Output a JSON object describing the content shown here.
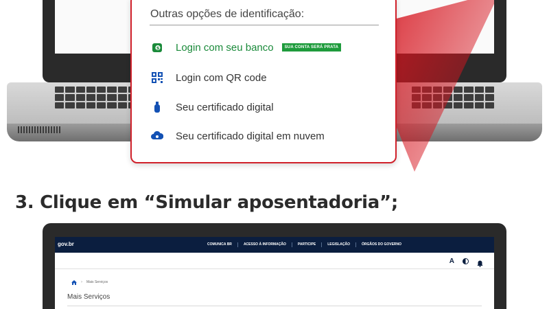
{
  "login_card": {
    "title": "Outras opções de identificação:",
    "options": [
      {
        "label": "Login com seu banco",
        "icon": "bank-login-icon",
        "badge": "SUA CONTA SERÁ PRATA"
      },
      {
        "label": "Login com QR code",
        "icon": "qr-code-icon"
      },
      {
        "label": "Seu certificado digital",
        "icon": "usb-token-icon"
      },
      {
        "label": "Seu certificado digital em nuvem",
        "icon": "cloud-certificate-icon"
      }
    ]
  },
  "step": {
    "heading": "3. Clique em “Simular aposentadoria”;"
  },
  "gov": {
    "logo": "gov.br",
    "nav": [
      "COMUNICA BR",
      "ACESSO À INFORMAÇÃO",
      "PARTICIPE",
      "LEGISLAÇÃO",
      "ÓRGÃOS DO GOVERNO"
    ],
    "tool_font": "A",
    "breadcrumb": "Mais Serviços",
    "page_title": "Mais Serviços"
  },
  "colors": {
    "accent_red": "#d0202a",
    "bank_green": "#1a8a3a",
    "icon_blue": "#1351b4",
    "gov_navy": "#0b1e3f"
  }
}
